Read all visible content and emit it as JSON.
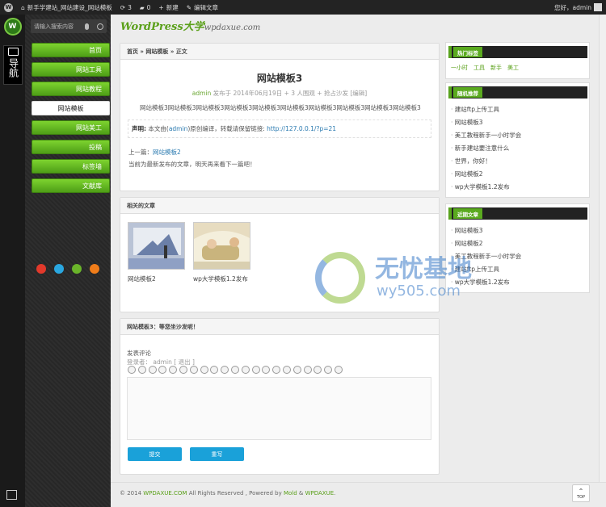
{
  "adminbar": {
    "site_name": "新手学建站_网站建设_网站模板",
    "updates": "3",
    "comments": "0",
    "new_label": "新建",
    "edit_label": "编辑文章",
    "greeting": "您好，admin"
  },
  "rail": {
    "nav_label": "导航"
  },
  "search": {
    "placeholder": "请输入搜索内容"
  },
  "menu": {
    "items": [
      "首页",
      "网站工具",
      "网站教程",
      "网站模板",
      "网站美工",
      "投稿",
      "标签墙",
      "文献库"
    ]
  },
  "header": {
    "logo_main": "WordPress大学",
    "logo_sub": "wpdaxue.com"
  },
  "post": {
    "breadcrumb": "首页 » 网站模板 » 正文",
    "title": "网站模板3",
    "meta_author": "admin",
    "meta_rest": "发布于 2014年06月19日 + 3 人围观 + 抢占沙发 [编辑]",
    "content": "网站模板3网站模板3网站模板3网站模板3网站模板3网站模板3网站模板3网站模板3网站模板3网站模板3",
    "statement_label": "声明:",
    "statement_pre": "本文由(",
    "statement_author": "admin",
    "statement_mid": ")原创编译，转载请保留链接:",
    "statement_link": "http://127.0.0.1/?p=21",
    "prev_label": "上一篇：",
    "prev_link": "网站模板2",
    "latest": "当前为最新发布的文章，明天再来看下一篇吧！"
  },
  "related": {
    "title": "相关的文章",
    "items": [
      {
        "caption": "网站模板2"
      },
      {
        "caption": "wp大学模板1.2发布"
      }
    ]
  },
  "comments": {
    "title": "网站模板3：等您坐沙发呢！",
    "label": "发表评论",
    "login": "登录者： admin [ 退出 ]",
    "submit": "提交",
    "reset": "重写"
  },
  "widgets": {
    "hot_tags": {
      "title": "热门标签",
      "tags": [
        "一小时",
        "工具",
        "新手",
        "美工"
      ]
    },
    "random": {
      "title": "随机推荐",
      "items": [
        "建站ftp上传工具",
        "网站模板3",
        "美工教程新手一小时学会",
        "新手建站要注意什么",
        "世界，你好！",
        "网站模板2",
        "wp大学模板1.2发布"
      ]
    },
    "recent": {
      "title": "近期文章",
      "items": [
        "网站模板3",
        "网站模板2",
        "美工教程新手一小时学会",
        "建站ftp上传工具",
        "wp大学模板1.2发布"
      ]
    }
  },
  "footer": {
    "pre": "© 2014 ",
    "site": "WPDAXUE.COM",
    "mid": " All Rights Reserved , Powered by ",
    "theme": "Mold",
    "amp": " & ",
    "author": "WPDAXUE",
    "end": "."
  },
  "top_button": "TOP",
  "watermark": {
    "brand": "无忧基地",
    "domain": "wy505.com"
  },
  "colors": {
    "accent_green": "#5aa019",
    "link_blue": "#2a7ab0",
    "button_blue": "#1aa1d9"
  }
}
